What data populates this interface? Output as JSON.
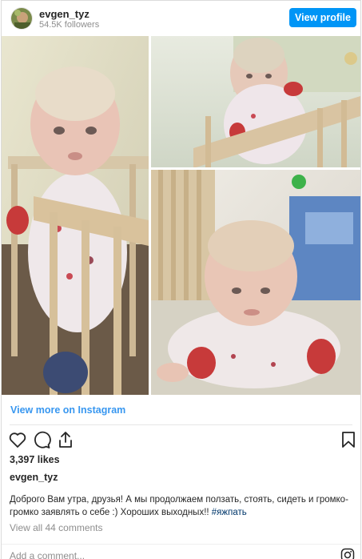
{
  "header": {
    "username": "evgen_tyz",
    "followers": "54.5K followers",
    "view_profile_label": "View profile"
  },
  "media": {
    "photo_count": 3
  },
  "view_more_label": "View more on Instagram",
  "actions": {
    "like_icon": "heart-icon",
    "comment_icon": "comment-icon",
    "share_icon": "share-icon",
    "save_icon": "bookmark-icon"
  },
  "likes": "3,397 likes",
  "caption": {
    "username": "evgen_tyz",
    "text": "Доброго Вам утра, друзья! А мы продолжаем ползать, стоять, сидеть и громко-громко заявлять о себе :) Хороших выходных!! ",
    "hashtag": "#яжпать"
  },
  "view_comments_label": "View all 44 comments",
  "add_comment_placeholder": "Add a comment...",
  "colors": {
    "accent": "#0095f6",
    "link": "#3897f0",
    "muted": "#8e8e8e",
    "text": "#262626"
  }
}
